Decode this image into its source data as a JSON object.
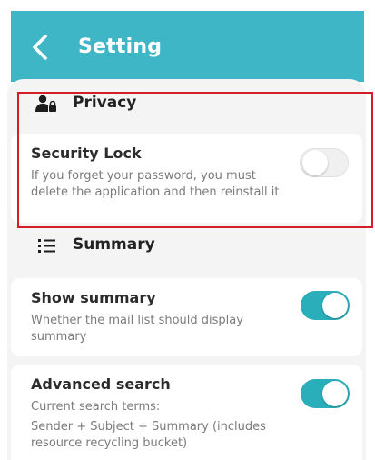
{
  "header": {
    "title": "Setting",
    "back_icon": "chevron-left-icon"
  },
  "privacy": {
    "section_title": "Privacy",
    "icon": "user-lock-icon",
    "security_lock": {
      "title": "Security Lock",
      "description": "If you forget your password, you must delete the application and then reinstall it",
      "enabled": false
    }
  },
  "summary": {
    "section_title": "Summary",
    "icon": "list-icon",
    "show_summary": {
      "title": "Show summary",
      "description": "Whether the mail list should display summary",
      "enabled": true
    },
    "advanced_search": {
      "title": "Advanced search",
      "description_line1": "Current search terms:",
      "description_line2": "Sender + Subject + Summary (includes resource recycling bucket)",
      "enabled": true
    }
  },
  "colors": {
    "header": "#3fb6c6",
    "toggle_on": "#2aaeb9",
    "highlight": "#d21e26"
  }
}
